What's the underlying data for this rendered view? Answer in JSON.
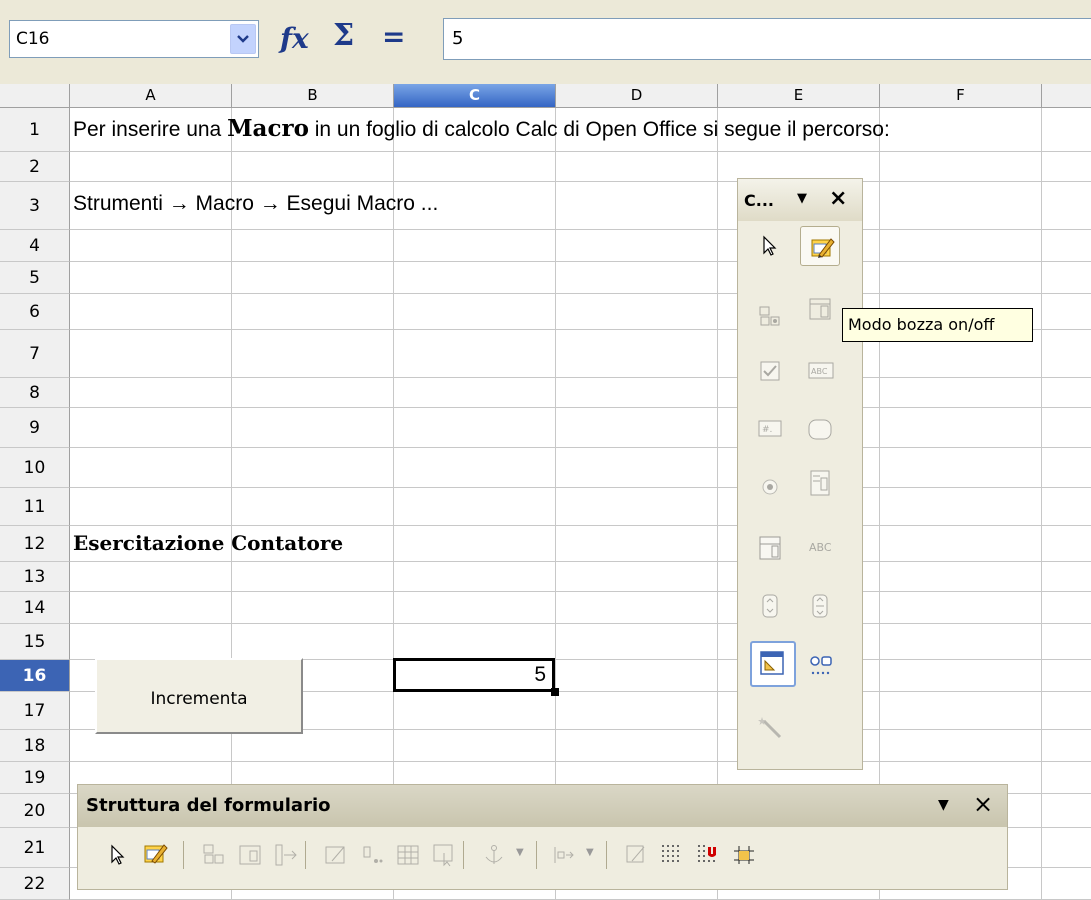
{
  "formula_bar": {
    "name_box": "C16",
    "function_wizard_label": "fx",
    "sum_label": "Σ",
    "equals_label": "=",
    "formula_value": "5"
  },
  "columns": [
    "A",
    "B",
    "C",
    "D",
    "E",
    "F"
  ],
  "selected_column": "C",
  "rows": [
    "1",
    "2",
    "3",
    "4",
    "5",
    "6",
    "7",
    "8",
    "9",
    "10",
    "11",
    "12",
    "13",
    "14",
    "15",
    "16",
    "17",
    "18",
    "19",
    "20",
    "21",
    "22"
  ],
  "selected_row": "16",
  "cells": {
    "a1_pre": "Per inserire una ",
    "a1_macro": "Macro",
    "a1_post": "  in un foglio di calcolo Calc di Open Office si segue il percorso:",
    "a3": "Strumenti → Macro → Esegui Macro ...",
    "a12": "Esercitazione  Contatore",
    "c16": "5"
  },
  "form_button": {
    "label": "Incrementa"
  },
  "controls_toolbar": {
    "title": "C...",
    "menu_arrow": "▼",
    "close": "×",
    "items": [
      "select",
      "design-mode",
      "group-box",
      "list-box",
      "check-box",
      "text-box",
      "formatted-field",
      "push-button",
      "option-button",
      "combo-box",
      "label-field",
      "abc",
      "spin-button",
      "scrollbar",
      "form-design",
      "more-controls",
      "wizards"
    ]
  },
  "tooltip": {
    "text": "Modo bozza on/off"
  },
  "form_design_toolbar": {
    "title": "Struttura del formulario",
    "menu_arrow": "▼",
    "close": "×"
  },
  "colors": {
    "toolbar_bg": "#ECE9D8",
    "selection_header": "#3C64B4",
    "tooltip_bg": "#FFFFE1"
  }
}
